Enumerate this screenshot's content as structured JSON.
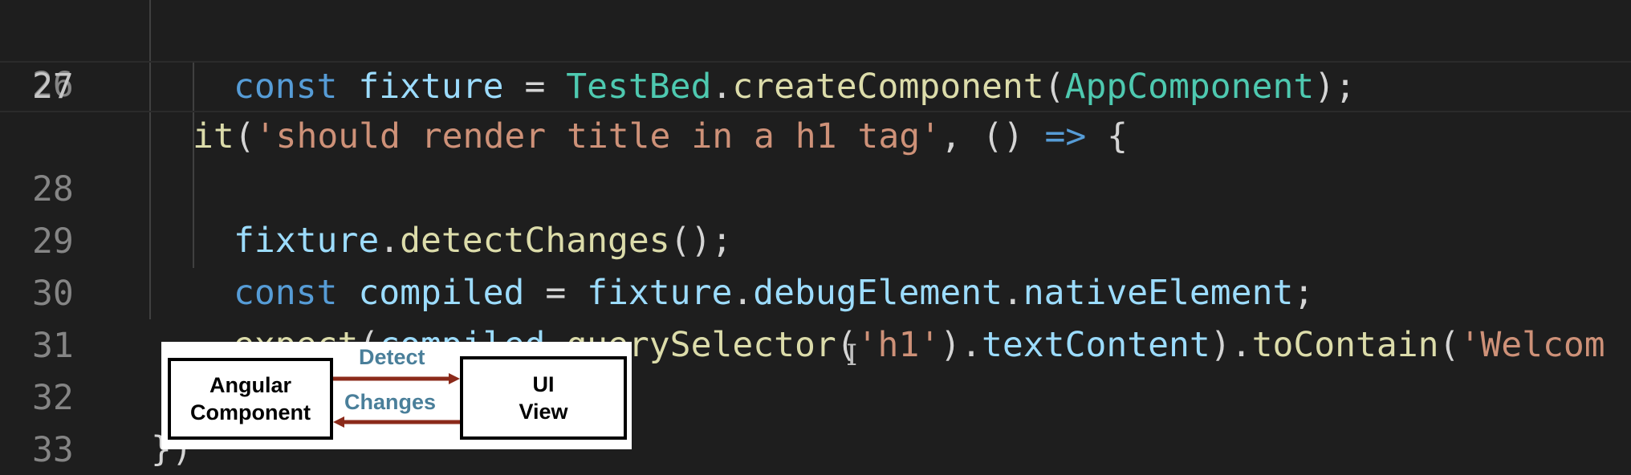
{
  "editor": {
    "lines": [
      {
        "number": "26",
        "tokens": [
          "it",
          "(",
          "'should render title in a h1 tag'",
          ", () ",
          "=>",
          " {"
        ]
      },
      {
        "number": "27",
        "tokens": [
          "const",
          " ",
          "fixture",
          " = ",
          "TestBed",
          ".",
          "createComponent",
          "(",
          "AppComponent",
          ");"
        ]
      },
      {
        "number": "28",
        "tokens": [
          "fixture",
          ".",
          "detectChanges",
          "();"
        ]
      },
      {
        "number": "29",
        "tokens": [
          "const",
          " ",
          "compiled",
          " = ",
          "fixture",
          ".",
          "debugElement",
          ".",
          "nativeElement",
          ";"
        ]
      },
      {
        "number": "30",
        "tokens": [
          "expect",
          "(",
          "compiled",
          ".",
          "querySelector",
          "(",
          "'h1'",
          ").",
          "textContent",
          ").",
          "toContain",
          "(",
          "'Welcom"
        ]
      },
      {
        "number": "31",
        "tokens": [
          "});"
        ]
      },
      {
        "number": "32",
        "tokens": [
          "})"
        ]
      },
      {
        "number": "33",
        "tokens": []
      }
    ],
    "active_line": "27"
  },
  "diagram": {
    "left_box": [
      "Angular",
      "Component"
    ],
    "right_box": [
      "UI",
      "View"
    ],
    "top_label": "Detect",
    "bottom_label": "Changes"
  },
  "colors": {
    "background": "#1e1e1e",
    "keyword": "#569cd6",
    "variable": "#9cdcfe",
    "function": "#dcdcaa",
    "class": "#4ec9b0",
    "string": "#ce9178",
    "arrow_line": "#8b2a1a"
  }
}
